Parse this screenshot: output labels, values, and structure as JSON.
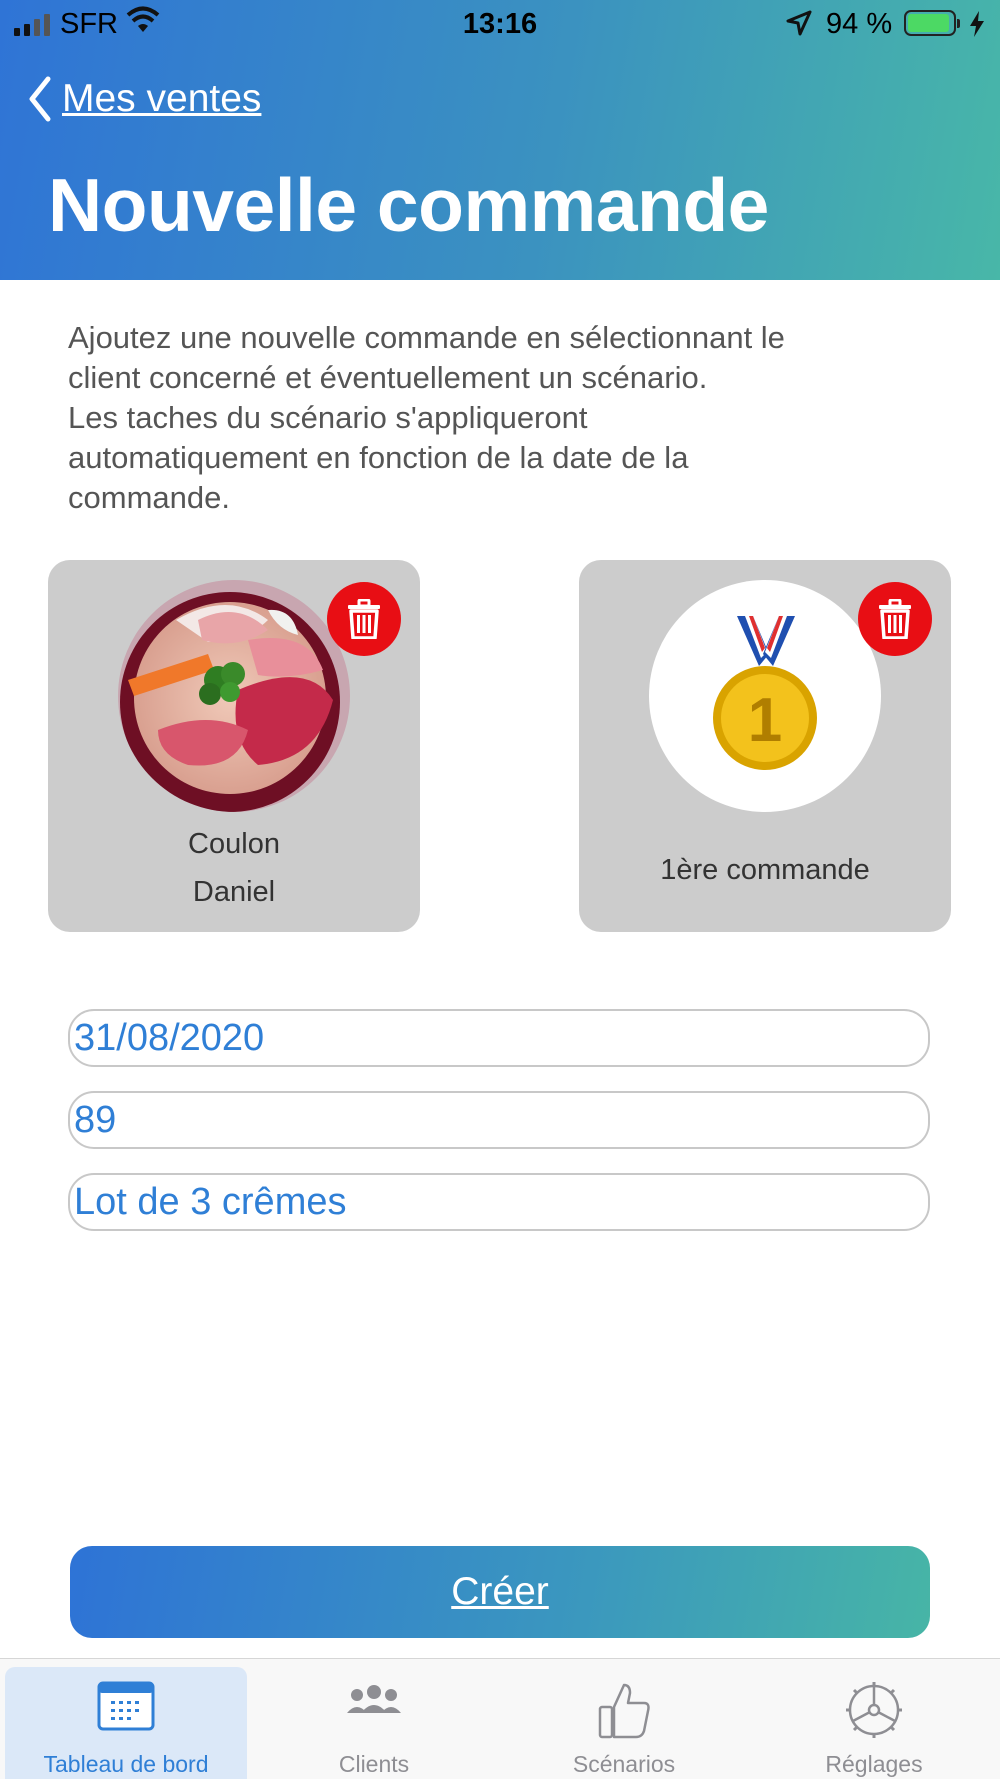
{
  "status_bar": {
    "carrier": "SFR",
    "time": "13:16",
    "battery_percent": "94 %",
    "battery_level": 0.94
  },
  "nav": {
    "back_label": "Mes ventes",
    "title": "Nouvelle commande"
  },
  "intro_text": "Ajoutez une nouvelle commande en sélectionnant le\nclient concerné et éventuellement un scénario.\nLes taches du scénario s'appliqueront\nautomatiquement en fonction de la date de la\ncommande.",
  "client_card": {
    "last_name": "Coulon",
    "first_name": "Daniel"
  },
  "scenario_card": {
    "name": "1ère commande",
    "medal_number": "1"
  },
  "fields": {
    "date": "31/08/2020",
    "amount": "89",
    "description": "Lot de 3 crêmes"
  },
  "create_button": "Créer",
  "tabs": [
    {
      "label": "Tableau de bord",
      "icon": "calendar-icon",
      "active": true
    },
    {
      "label": "Clients",
      "icon": "people-icon",
      "active": false
    },
    {
      "label": "Scénarios",
      "icon": "thumbs-up-icon",
      "active": false
    },
    {
      "label": "Réglages",
      "icon": "settings-icon",
      "active": false
    }
  ],
  "colors": {
    "header_gradient_start": "#2f74d6",
    "header_gradient_end": "#48b7a8",
    "delete_red": "#e80e14",
    "field_text_blue": "#2f7fd6"
  }
}
